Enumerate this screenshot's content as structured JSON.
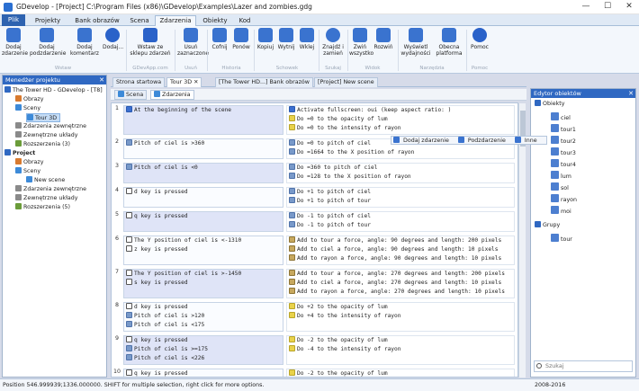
{
  "window": {
    "title": "GDevelop - [Project] C:\\Program Files (x86)\\GDevelop\\Examples\\Lazer and zombies.gdg",
    "minimize": "—",
    "maximize": "☐",
    "close": "✕"
  },
  "ribbon_tabs": [
    "Plik",
    "Projekty",
    "Bank obrazów",
    "Scena",
    "Zdarzenia",
    "Obiekty",
    "Kod"
  ],
  "ribbon_buttons": [
    {
      "label": "Dodaj zdarzenie",
      "icon": "add-event-icon",
      "color": "#3a73cf"
    },
    {
      "label": "Dodaj podzdarzenie",
      "icon": "add-subevent-icon",
      "color": "#3a73cf"
    },
    {
      "label": "Dodaj komentarz",
      "icon": "add-comment-icon",
      "color": "#3a73cf"
    },
    {
      "label": "Dodaj...",
      "icon": "add-more-icon",
      "color": "#2a62c9"
    },
    {
      "label": "Wstaw ze sklepu zdarzeń",
      "icon": "store-icon",
      "color": "#2a62c9"
    },
    {
      "label": "Usuń zaznaczone",
      "icon": "delete-icon",
      "color": "#3a73cf"
    },
    {
      "label": "Cofnij",
      "icon": "undo-icon",
      "color": "#3a73cf"
    },
    {
      "label": "Ponów",
      "icon": "redo-icon",
      "color": "#3a73cf"
    },
    {
      "label": "Kopiuj",
      "icon": "copy-icon",
      "color": "#3a73cf"
    },
    {
      "label": "Wytnij",
      "icon": "cut-icon",
      "color": "#3a73cf"
    },
    {
      "label": "Wklej",
      "icon": "paste-icon",
      "color": "#3a73cf"
    },
    {
      "label": "Znajdź i zamień",
      "icon": "find-icon",
      "color": "#3a73cf"
    },
    {
      "label": "Zwiń wszystko",
      "icon": "collapse-icon",
      "color": "#3a73cf"
    },
    {
      "label": "Rozwiń",
      "icon": "expand-icon",
      "color": "#3a73cf"
    },
    {
      "label": "Wyświetl wydajności",
      "icon": "performance-icon",
      "color": "#3a73cf"
    },
    {
      "label": "Obecna platforma",
      "icon": "platform-icon",
      "color": "#3a73cf"
    },
    {
      "label": "Pomoc",
      "icon": "help-icon",
      "color": "#2a62c9"
    }
  ],
  "ribbon_groups": [
    "Wstaw",
    "GDevApp.com",
    "Usuń",
    "Historia",
    "Schowek",
    "Szukaj",
    "Widok",
    "Narzędzia",
    "Pomoc"
  ],
  "project_manager": {
    "title": "Menedżer projektu",
    "close": "✕",
    "tree": [
      {
        "label": "The Tower HD - GDevelop - [T8]",
        "icon": "project-icon"
      },
      {
        "label": "Obrazy",
        "icon": "images-icon"
      },
      {
        "label": "Sceny",
        "icon": "scenes-icon"
      },
      {
        "label": "Tour 3D",
        "icon": "scene-icon"
      },
      {
        "label": "Zdarzenia zewnętrzne",
        "icon": "external-events-icon"
      },
      {
        "label": "Zewnętrzne układy",
        "icon": "external-layouts-icon"
      },
      {
        "label": "Rozszerzenia (3)",
        "icon": "extensions-icon"
      },
      {
        "label": "Project",
        "icon": "project-icon"
      },
      {
        "label": "Obrazy",
        "icon": "images-icon"
      },
      {
        "label": "Sceny",
        "icon": "scenes-icon"
      },
      {
        "label": "New scene",
        "icon": "scene-icon"
      },
      {
        "label": "Zdarzenia zewnętrzne",
        "icon": "external-events-icon"
      },
      {
        "label": "Zewnętrzne układy",
        "icon": "external-layouts-icon"
      },
      {
        "label": "Rozszerzenia (5)",
        "icon": "extensions-icon"
      }
    ]
  },
  "doc_tabs": [
    {
      "label": "Strona startowa"
    },
    {
      "label": "Tour 3D",
      "close": "✕"
    },
    {
      "label": "[The Tower HD...] Bank obrazów"
    },
    {
      "label": "[Project] New scene"
    }
  ],
  "sub_tabs": [
    "Scena",
    "Zdarzenia"
  ],
  "floating_toolbar": [
    "Dodaj zdarzenie",
    "Podzdarzenie",
    "Inne"
  ],
  "events": [
    {
      "num": "1",
      "conditions": [
        {
          "text": "At the beginning of the scene",
          "icon": "timer-icon"
        }
      ],
      "actions": [
        {
          "text": "Activate fullscreen: oui (keep aspect ratio: )",
          "icon": "screen-icon"
        },
        {
          "text": "Do =0 to the opacity of lum",
          "icon": "light-icon"
        },
        {
          "text": "Do =0 to the intensity of rayon",
          "icon": "light-icon"
        }
      ]
    },
    {
      "num": "2",
      "conditions": [
        {
          "text": "Pitch of ciel is >360",
          "icon": "object-icon"
        }
      ],
      "actions": [
        {
          "text": "Do =0 to pitch of ciel",
          "icon": "object-icon"
        },
        {
          "text": "Do =1664 to the X position of rayon",
          "icon": "object-icon"
        }
      ]
    },
    {
      "num": "3",
      "conditions": [
        {
          "text": "Pitch of ciel is <0",
          "icon": "object-icon"
        }
      ],
      "actions": [
        {
          "text": "Do =360 to pitch of ciel",
          "icon": "object-icon"
        },
        {
          "text": "Do =128 to the X position of rayon",
          "icon": "object-icon"
        }
      ]
    },
    {
      "num": "4",
      "conditions": [
        {
          "text": "d key is pressed",
          "icon": "key-icon"
        }
      ],
      "actions": [
        {
          "text": "Do +1 to pitch of ciel",
          "icon": "object-icon"
        },
        {
          "text": "Do +1 to pitch of tour",
          "icon": "object-icon"
        }
      ]
    },
    {
      "num": "5",
      "conditions": [
        {
          "text": "q key is pressed",
          "icon": "key-icon"
        }
      ],
      "actions": [
        {
          "text": "Do -1 to pitch of ciel",
          "icon": "object-icon"
        },
        {
          "text": "Do -1 to pitch of tour",
          "icon": "object-icon"
        }
      ]
    },
    {
      "num": "6",
      "conditions": [
        {
          "text": "The Y position of ciel is <-1310",
          "icon": "position-icon"
        },
        {
          "text": "z key is pressed",
          "icon": "key-icon"
        }
      ],
      "actions": [
        {
          "text": "Add to tour a force, angle: 90 degrees and length: 200 pixels",
          "icon": "force-icon"
        },
        {
          "text": "Add to ciel a force, angle: 90 degrees and length: 10 pixels",
          "icon": "force-icon"
        },
        {
          "text": "Add to rayon a force, angle: 90 degrees and length: 10 pixels",
          "icon": "force-icon"
        }
      ]
    },
    {
      "num": "7",
      "conditions": [
        {
          "text": "The Y position of ciel is >-1450",
          "icon": "position-icon"
        },
        {
          "text": "s key is pressed",
          "icon": "key-icon"
        }
      ],
      "actions": [
        {
          "text": "Add to tour a force, angle: 270 degrees and length: 200 pixels",
          "icon": "force-icon"
        },
        {
          "text": "Add to ciel a force, angle: 270 degrees and length: 10 pixels",
          "icon": "force-icon"
        },
        {
          "text": "Add to rayon a force, angle: 270 degrees and length: 10 pixels",
          "icon": "force-icon"
        }
      ]
    },
    {
      "num": "8",
      "conditions": [
        {
          "text": "d key is pressed",
          "icon": "key-icon"
        },
        {
          "text": "Pitch of ciel is >120",
          "icon": "object-icon"
        },
        {
          "text": "Pitch of ciel is <175",
          "icon": "object-icon"
        }
      ],
      "actions": [
        {
          "text": "Do +2 to the opacity of lum",
          "icon": "light-icon"
        },
        {
          "text": "Do +4 to the intensity of rayon",
          "icon": "light-icon"
        }
      ]
    },
    {
      "num": "9",
      "conditions": [
        {
          "text": "q key is pressed",
          "icon": "key-icon"
        },
        {
          "text": "Pitch of ciel is >=175",
          "icon": "object-icon"
        },
        {
          "text": "Pitch of ciel is <226",
          "icon": "object-icon"
        }
      ],
      "actions": [
        {
          "text": "Do -2 to the opacity of lum",
          "icon": "light-icon"
        },
        {
          "text": "Do -4 to the intensity of rayon",
          "icon": "light-icon"
        }
      ]
    },
    {
      "num": "10",
      "conditions": [
        {
          "text": "q key is pressed",
          "icon": "key-icon"
        },
        {
          "text": "Pitch of ciel is >120",
          "icon": "object-icon"
        },
        {
          "text": "Pitch of ciel is <175",
          "icon": "object-icon"
        }
      ],
      "actions": [
        {
          "text": "Do -2 to the opacity of lum",
          "icon": "light-icon"
        },
        {
          "text": "Do -4 to the intensity of rayon",
          "icon": "light-icon"
        }
      ]
    }
  ],
  "object_editor": {
    "title": "Edytor obiektów",
    "close": "✕",
    "groups": [
      {
        "label": "Obiekty",
        "items": [
          "ciel",
          "tour1",
          "tour2",
          "tour3",
          "tour4",
          "lum",
          "sol",
          "rayon",
          "moi"
        ]
      },
      {
        "label": "Grupy",
        "items": [
          "tour"
        ]
      }
    ],
    "search_placeholder": "Szukaj"
  },
  "status": {
    "text": "Position 546.999939;1336.000000. SHIFT for multiple selection, right click for more options.",
    "right": "2008-2016"
  }
}
